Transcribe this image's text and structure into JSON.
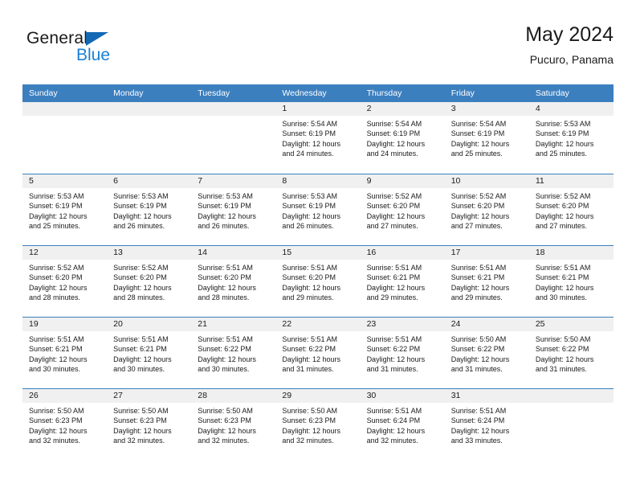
{
  "logo": {
    "primary_text": "General",
    "secondary_text": "Blue",
    "triangle_icon": "triangle-icon",
    "primary_color": "#1a1a1a",
    "secondary_color": "#1a7fd4"
  },
  "header": {
    "title": "May 2024",
    "subtitle": "Pucuro, Panama"
  },
  "colors": {
    "header_bar": "#3c7fbf",
    "day_number_strip": "#f0f0f0",
    "row_divider": "#3c7fbf",
    "text": "#1a1a1a"
  },
  "weekdays": [
    "Sunday",
    "Monday",
    "Tuesday",
    "Wednesday",
    "Thursday",
    "Friday",
    "Saturday"
  ],
  "weeks": [
    [
      {
        "day": "",
        "empty": true,
        "sunrise": "",
        "sunset": "",
        "daylight_line1": "",
        "daylight_line2": ""
      },
      {
        "day": "",
        "empty": true,
        "sunrise": "",
        "sunset": "",
        "daylight_line1": "",
        "daylight_line2": ""
      },
      {
        "day": "",
        "empty": true,
        "sunrise": "",
        "sunset": "",
        "daylight_line1": "",
        "daylight_line2": ""
      },
      {
        "day": "1",
        "empty": false,
        "sunrise": "Sunrise: 5:54 AM",
        "sunset": "Sunset: 6:19 PM",
        "daylight_line1": "Daylight: 12 hours",
        "daylight_line2": "and 24 minutes."
      },
      {
        "day": "2",
        "empty": false,
        "sunrise": "Sunrise: 5:54 AM",
        "sunset": "Sunset: 6:19 PM",
        "daylight_line1": "Daylight: 12 hours",
        "daylight_line2": "and 24 minutes."
      },
      {
        "day": "3",
        "empty": false,
        "sunrise": "Sunrise: 5:54 AM",
        "sunset": "Sunset: 6:19 PM",
        "daylight_line1": "Daylight: 12 hours",
        "daylight_line2": "and 25 minutes."
      },
      {
        "day": "4",
        "empty": false,
        "sunrise": "Sunrise: 5:53 AM",
        "sunset": "Sunset: 6:19 PM",
        "daylight_line1": "Daylight: 12 hours",
        "daylight_line2": "and 25 minutes."
      }
    ],
    [
      {
        "day": "5",
        "empty": false,
        "sunrise": "Sunrise: 5:53 AM",
        "sunset": "Sunset: 6:19 PM",
        "daylight_line1": "Daylight: 12 hours",
        "daylight_line2": "and 25 minutes."
      },
      {
        "day": "6",
        "empty": false,
        "sunrise": "Sunrise: 5:53 AM",
        "sunset": "Sunset: 6:19 PM",
        "daylight_line1": "Daylight: 12 hours",
        "daylight_line2": "and 26 minutes."
      },
      {
        "day": "7",
        "empty": false,
        "sunrise": "Sunrise: 5:53 AM",
        "sunset": "Sunset: 6:19 PM",
        "daylight_line1": "Daylight: 12 hours",
        "daylight_line2": "and 26 minutes."
      },
      {
        "day": "8",
        "empty": false,
        "sunrise": "Sunrise: 5:53 AM",
        "sunset": "Sunset: 6:19 PM",
        "daylight_line1": "Daylight: 12 hours",
        "daylight_line2": "and 26 minutes."
      },
      {
        "day": "9",
        "empty": false,
        "sunrise": "Sunrise: 5:52 AM",
        "sunset": "Sunset: 6:20 PM",
        "daylight_line1": "Daylight: 12 hours",
        "daylight_line2": "and 27 minutes."
      },
      {
        "day": "10",
        "empty": false,
        "sunrise": "Sunrise: 5:52 AM",
        "sunset": "Sunset: 6:20 PM",
        "daylight_line1": "Daylight: 12 hours",
        "daylight_line2": "and 27 minutes."
      },
      {
        "day": "11",
        "empty": false,
        "sunrise": "Sunrise: 5:52 AM",
        "sunset": "Sunset: 6:20 PM",
        "daylight_line1": "Daylight: 12 hours",
        "daylight_line2": "and 27 minutes."
      }
    ],
    [
      {
        "day": "12",
        "empty": false,
        "sunrise": "Sunrise: 5:52 AM",
        "sunset": "Sunset: 6:20 PM",
        "daylight_line1": "Daylight: 12 hours",
        "daylight_line2": "and 28 minutes."
      },
      {
        "day": "13",
        "empty": false,
        "sunrise": "Sunrise: 5:52 AM",
        "sunset": "Sunset: 6:20 PM",
        "daylight_line1": "Daylight: 12 hours",
        "daylight_line2": "and 28 minutes."
      },
      {
        "day": "14",
        "empty": false,
        "sunrise": "Sunrise: 5:51 AM",
        "sunset": "Sunset: 6:20 PM",
        "daylight_line1": "Daylight: 12 hours",
        "daylight_line2": "and 28 minutes."
      },
      {
        "day": "15",
        "empty": false,
        "sunrise": "Sunrise: 5:51 AM",
        "sunset": "Sunset: 6:20 PM",
        "daylight_line1": "Daylight: 12 hours",
        "daylight_line2": "and 29 minutes."
      },
      {
        "day": "16",
        "empty": false,
        "sunrise": "Sunrise: 5:51 AM",
        "sunset": "Sunset: 6:21 PM",
        "daylight_line1": "Daylight: 12 hours",
        "daylight_line2": "and 29 minutes."
      },
      {
        "day": "17",
        "empty": false,
        "sunrise": "Sunrise: 5:51 AM",
        "sunset": "Sunset: 6:21 PM",
        "daylight_line1": "Daylight: 12 hours",
        "daylight_line2": "and 29 minutes."
      },
      {
        "day": "18",
        "empty": false,
        "sunrise": "Sunrise: 5:51 AM",
        "sunset": "Sunset: 6:21 PM",
        "daylight_line1": "Daylight: 12 hours",
        "daylight_line2": "and 30 minutes."
      }
    ],
    [
      {
        "day": "19",
        "empty": false,
        "sunrise": "Sunrise: 5:51 AM",
        "sunset": "Sunset: 6:21 PM",
        "daylight_line1": "Daylight: 12 hours",
        "daylight_line2": "and 30 minutes."
      },
      {
        "day": "20",
        "empty": false,
        "sunrise": "Sunrise: 5:51 AM",
        "sunset": "Sunset: 6:21 PM",
        "daylight_line1": "Daylight: 12 hours",
        "daylight_line2": "and 30 minutes."
      },
      {
        "day": "21",
        "empty": false,
        "sunrise": "Sunrise: 5:51 AM",
        "sunset": "Sunset: 6:22 PM",
        "daylight_line1": "Daylight: 12 hours",
        "daylight_line2": "and 30 minutes."
      },
      {
        "day": "22",
        "empty": false,
        "sunrise": "Sunrise: 5:51 AM",
        "sunset": "Sunset: 6:22 PM",
        "daylight_line1": "Daylight: 12 hours",
        "daylight_line2": "and 31 minutes."
      },
      {
        "day": "23",
        "empty": false,
        "sunrise": "Sunrise: 5:51 AM",
        "sunset": "Sunset: 6:22 PM",
        "daylight_line1": "Daylight: 12 hours",
        "daylight_line2": "and 31 minutes."
      },
      {
        "day": "24",
        "empty": false,
        "sunrise": "Sunrise: 5:50 AM",
        "sunset": "Sunset: 6:22 PM",
        "daylight_line1": "Daylight: 12 hours",
        "daylight_line2": "and 31 minutes."
      },
      {
        "day": "25",
        "empty": false,
        "sunrise": "Sunrise: 5:50 AM",
        "sunset": "Sunset: 6:22 PM",
        "daylight_line1": "Daylight: 12 hours",
        "daylight_line2": "and 31 minutes."
      }
    ],
    [
      {
        "day": "26",
        "empty": false,
        "sunrise": "Sunrise: 5:50 AM",
        "sunset": "Sunset: 6:23 PM",
        "daylight_line1": "Daylight: 12 hours",
        "daylight_line2": "and 32 minutes."
      },
      {
        "day": "27",
        "empty": false,
        "sunrise": "Sunrise: 5:50 AM",
        "sunset": "Sunset: 6:23 PM",
        "daylight_line1": "Daylight: 12 hours",
        "daylight_line2": "and 32 minutes."
      },
      {
        "day": "28",
        "empty": false,
        "sunrise": "Sunrise: 5:50 AM",
        "sunset": "Sunset: 6:23 PM",
        "daylight_line1": "Daylight: 12 hours",
        "daylight_line2": "and 32 minutes."
      },
      {
        "day": "29",
        "empty": false,
        "sunrise": "Sunrise: 5:50 AM",
        "sunset": "Sunset: 6:23 PM",
        "daylight_line1": "Daylight: 12 hours",
        "daylight_line2": "and 32 minutes."
      },
      {
        "day": "30",
        "empty": false,
        "sunrise": "Sunrise: 5:51 AM",
        "sunset": "Sunset: 6:24 PM",
        "daylight_line1": "Daylight: 12 hours",
        "daylight_line2": "and 32 minutes."
      },
      {
        "day": "31",
        "empty": false,
        "sunrise": "Sunrise: 5:51 AM",
        "sunset": "Sunset: 6:24 PM",
        "daylight_line1": "Daylight: 12 hours",
        "daylight_line2": "and 33 minutes."
      },
      {
        "day": "",
        "empty": true,
        "sunrise": "",
        "sunset": "",
        "daylight_line1": "",
        "daylight_line2": ""
      }
    ]
  ]
}
